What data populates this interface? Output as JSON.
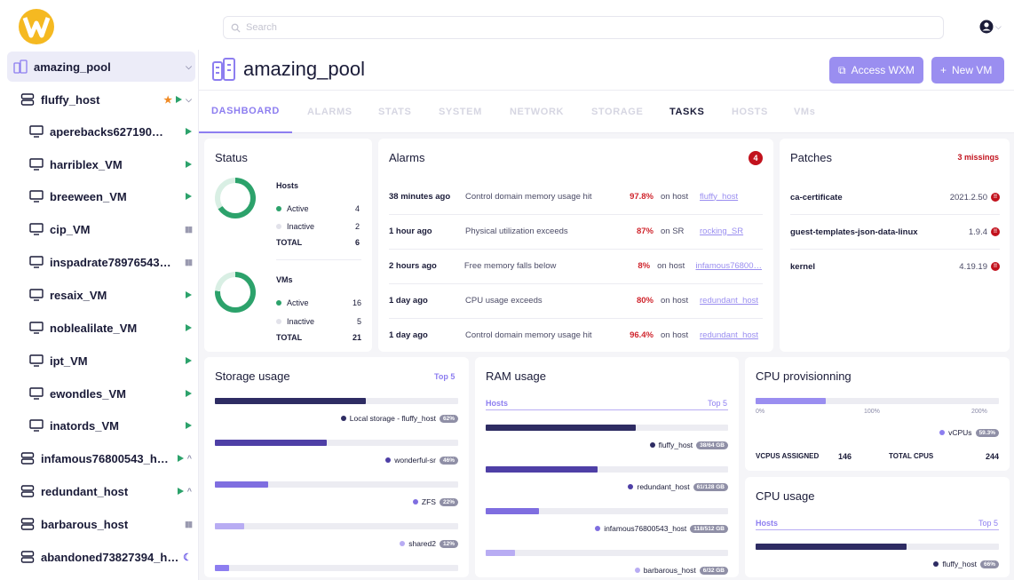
{
  "search": {
    "placeholder": "Search"
  },
  "sidebar": {
    "items": [
      {
        "label": "amazing_pool",
        "kind": "pool",
        "trail": "chevron"
      },
      {
        "label": "fluffy_host",
        "kind": "host",
        "trail": "star-play-chevron"
      },
      {
        "label": "aperebacks627190…",
        "kind": "vm",
        "trail": "play"
      },
      {
        "label": "harriblex_VM",
        "kind": "vm",
        "trail": "play"
      },
      {
        "label": "breeween_VM",
        "kind": "vm",
        "trail": "play"
      },
      {
        "label": "cip_VM",
        "kind": "vm",
        "trail": "pause"
      },
      {
        "label": "inspadrate78976543…",
        "kind": "vm",
        "trail": "pause"
      },
      {
        "label": "resaix_VM",
        "kind": "vm",
        "trail": "play"
      },
      {
        "label": "noblealilate_VM",
        "kind": "vm",
        "trail": "play"
      },
      {
        "label": "ipt_VM",
        "kind": "vm",
        "trail": "play"
      },
      {
        "label": "ewondles_VM",
        "kind": "vm",
        "trail": "play"
      },
      {
        "label": "inatords_VM",
        "kind": "vm",
        "trail": "play"
      },
      {
        "label": "infamous76800543_h…",
        "kind": "host",
        "trail": "play-chevron"
      },
      {
        "label": "redundant_host",
        "kind": "host",
        "trail": "play-chevron"
      },
      {
        "label": "barbarous_host",
        "kind": "host",
        "trail": "pause"
      },
      {
        "label": "abandoned73827394_h…",
        "kind": "host",
        "trail": "moon"
      }
    ]
  },
  "header": {
    "title": "amazing_pool",
    "access_label": "Access WXM",
    "newvm_label": "New VM"
  },
  "tabs": [
    "DASHBOARD",
    "ALARMS",
    "STATS",
    "SYSTEM",
    "NETWORK",
    "STORAGE",
    "TASKS",
    "HOSTS",
    "VMs"
  ],
  "status": {
    "title": "Status",
    "hosts": {
      "title": "Hosts",
      "active_label": "Active",
      "active": "4",
      "inactive_label": "Inactive",
      "inactive": "2",
      "total_label": "TOTAL",
      "total": "6"
    },
    "vms": {
      "title": "VMs",
      "active_label": "Active",
      "active": "16",
      "inactive_label": "Inactive",
      "inactive": "5",
      "total_label": "TOTAL",
      "total": "21"
    }
  },
  "alarms": {
    "title": "Alarms",
    "count": "4",
    "rows": [
      {
        "time": "38 minutes ago",
        "msg": "Control domain memory usage hit",
        "pct": "97.8%",
        "on": "on host",
        "target": "fluffy_host"
      },
      {
        "time": "1 hour ago",
        "msg": "Physical utilization exceeds",
        "pct": "87%",
        "on": "on SR",
        "target": "rocking_SR"
      },
      {
        "time": "2 hours ago",
        "msg": "Free memory falls below",
        "pct": "8%",
        "on": "on host",
        "target": "infamous76800…"
      },
      {
        "time": "1 day ago",
        "msg": "CPU usage exceeds",
        "pct": "80%",
        "on": "on host",
        "target": "redundant_host"
      },
      {
        "time": "1 day ago",
        "msg": "Control domain memory usage hit",
        "pct": "96.4%",
        "on": "on host",
        "target": "redundant_host"
      }
    ]
  },
  "patches": {
    "title": "Patches",
    "missing": "3 missings",
    "rows": [
      {
        "name": "ca-certificate",
        "version": "2021.2.50"
      },
      {
        "name": "guest-templates-json-data-linux",
        "version": "1.9.4"
      },
      {
        "name": "kernel",
        "version": "4.19.19"
      }
    ]
  },
  "storage": {
    "title": "Storage usage",
    "top": "Top 5",
    "rows": [
      {
        "label": "Local storage - fluffy_host",
        "pct": "62%",
        "fill": 0.62,
        "color": "#2e2c63"
      },
      {
        "label": "wonderful-sr",
        "pct": "46%",
        "fill": 0.46,
        "color": "#4e3fa6"
      },
      {
        "label": "ZFS",
        "pct": "22%",
        "fill": 0.22,
        "color": "#7f6ee0"
      },
      {
        "label": "shared2",
        "pct": "12%",
        "fill": 0.12,
        "color": "#b8acf3"
      },
      {
        "label": "",
        "pct": "",
        "fill": 0.06,
        "color": "#8d7ef0"
      }
    ]
  },
  "ram": {
    "title": "RAM usage",
    "hosts_label": "Hosts",
    "top": "Top 5",
    "rows": [
      {
        "label": "fluffy_host",
        "pct": "38/64 GB",
        "fill": 0.62,
        "color": "#2e2c63"
      },
      {
        "label": "redundant_host",
        "pct": "61/128 GB",
        "fill": 0.46,
        "color": "#4e3fa6"
      },
      {
        "label": "infamous76800543_host",
        "pct": "118/512 GB",
        "fill": 0.22,
        "color": "#7f6ee0"
      },
      {
        "label": "barbarous_host",
        "pct": "6/32 GB",
        "fill": 0.12,
        "color": "#b8acf3"
      }
    ]
  },
  "cpuprov": {
    "title": "CPU provisionning",
    "fill": 0.29,
    "ticks": [
      "0%",
      "100%",
      "200%"
    ],
    "legend": "vCPUs",
    "legend_pct": "59.3%",
    "assigned_label": "VCPUS ASSIGNED",
    "assigned": "146",
    "total_label": "TOTAL CPUS",
    "total": "244"
  },
  "cpuusage": {
    "title": "CPU usage",
    "hosts_label": "Hosts",
    "top": "Top 5",
    "rows": [
      {
        "label": "fluffy_host",
        "pct": "66%",
        "fill": 0.62,
        "color": "#2e2c63"
      }
    ]
  }
}
